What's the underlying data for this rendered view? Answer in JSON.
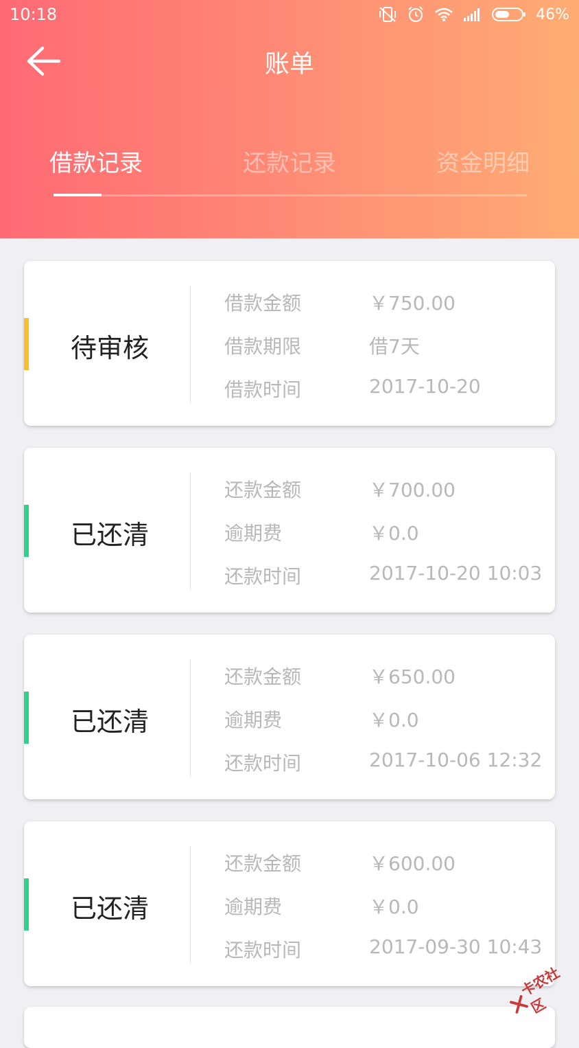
{
  "status_bar": {
    "time": "10:18",
    "battery": "46%"
  },
  "header": {
    "title": "账单"
  },
  "tabs": [
    {
      "label": "借款记录",
      "active": true
    },
    {
      "label": "还款记录",
      "active": false
    },
    {
      "label": "资金明细",
      "active": false
    }
  ],
  "colors": {
    "pending": "#f9bf2c",
    "cleared": "#2fd18c"
  },
  "records": [
    {
      "status": "待审核",
      "rows": [
        {
          "label": "借款金额",
          "value": "￥750.00"
        },
        {
          "label": "借款期限",
          "value": "借7天"
        },
        {
          "label": "借款时间",
          "value": "2017-10-20"
        }
      ]
    },
    {
      "status": "已还清",
      "rows": [
        {
          "label": "还款金额",
          "value": "￥700.00"
        },
        {
          "label": "逾期费",
          "value": "￥0.0"
        },
        {
          "label": "还款时间",
          "value": "2017-10-20 10:03"
        }
      ]
    },
    {
      "status": "已还清",
      "rows": [
        {
          "label": "还款金额",
          "value": "￥650.00"
        },
        {
          "label": "逾期费",
          "value": "￥0.0"
        },
        {
          "label": "还款时间",
          "value": "2017-10-06 12:32"
        }
      ]
    },
    {
      "status": "已还清",
      "rows": [
        {
          "label": "还款金额",
          "value": "￥600.00"
        },
        {
          "label": "逾期费",
          "value": "￥0.0"
        },
        {
          "label": "还款时间",
          "value": "2017-09-30 10:43"
        }
      ]
    }
  ],
  "watermark": {
    "text": "卡农社区"
  }
}
